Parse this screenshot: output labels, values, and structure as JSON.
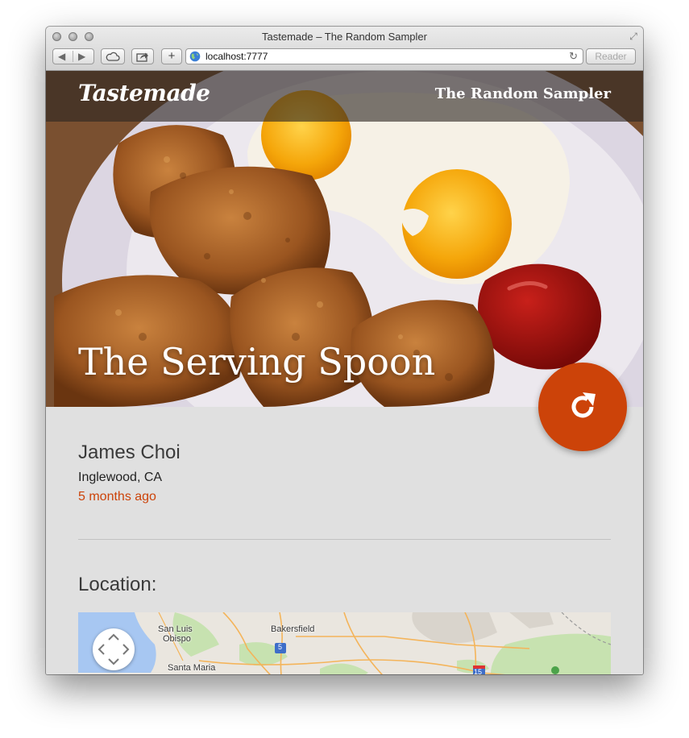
{
  "window": {
    "title": "Tastemade – The Random Sampler",
    "url": "localhost:7777",
    "reader_label": "Reader"
  },
  "header": {
    "logo": "Tastemade",
    "site_name": "The Random Sampler"
  },
  "hero": {
    "title": "The Serving Spoon"
  },
  "post": {
    "author": "James Choi",
    "location": "Inglewood, CA",
    "time_ago": "5 months ago"
  },
  "location_section": {
    "heading": "Location:"
  },
  "map": {
    "labels": {
      "san_luis": "San Luis",
      "obispo": "Obispo",
      "bakersfield": "Bakersfield",
      "santa_maria": "Santa Maria",
      "route_5": "5",
      "route_15": "15"
    }
  },
  "colors": {
    "accent": "#cc4309",
    "page_bg": "#e0e0e0",
    "header_overlay": "#2d2622"
  },
  "icons": {
    "refresh": "refresh-icon",
    "pan": "map-pan-icon",
    "globe": "globe-icon"
  }
}
